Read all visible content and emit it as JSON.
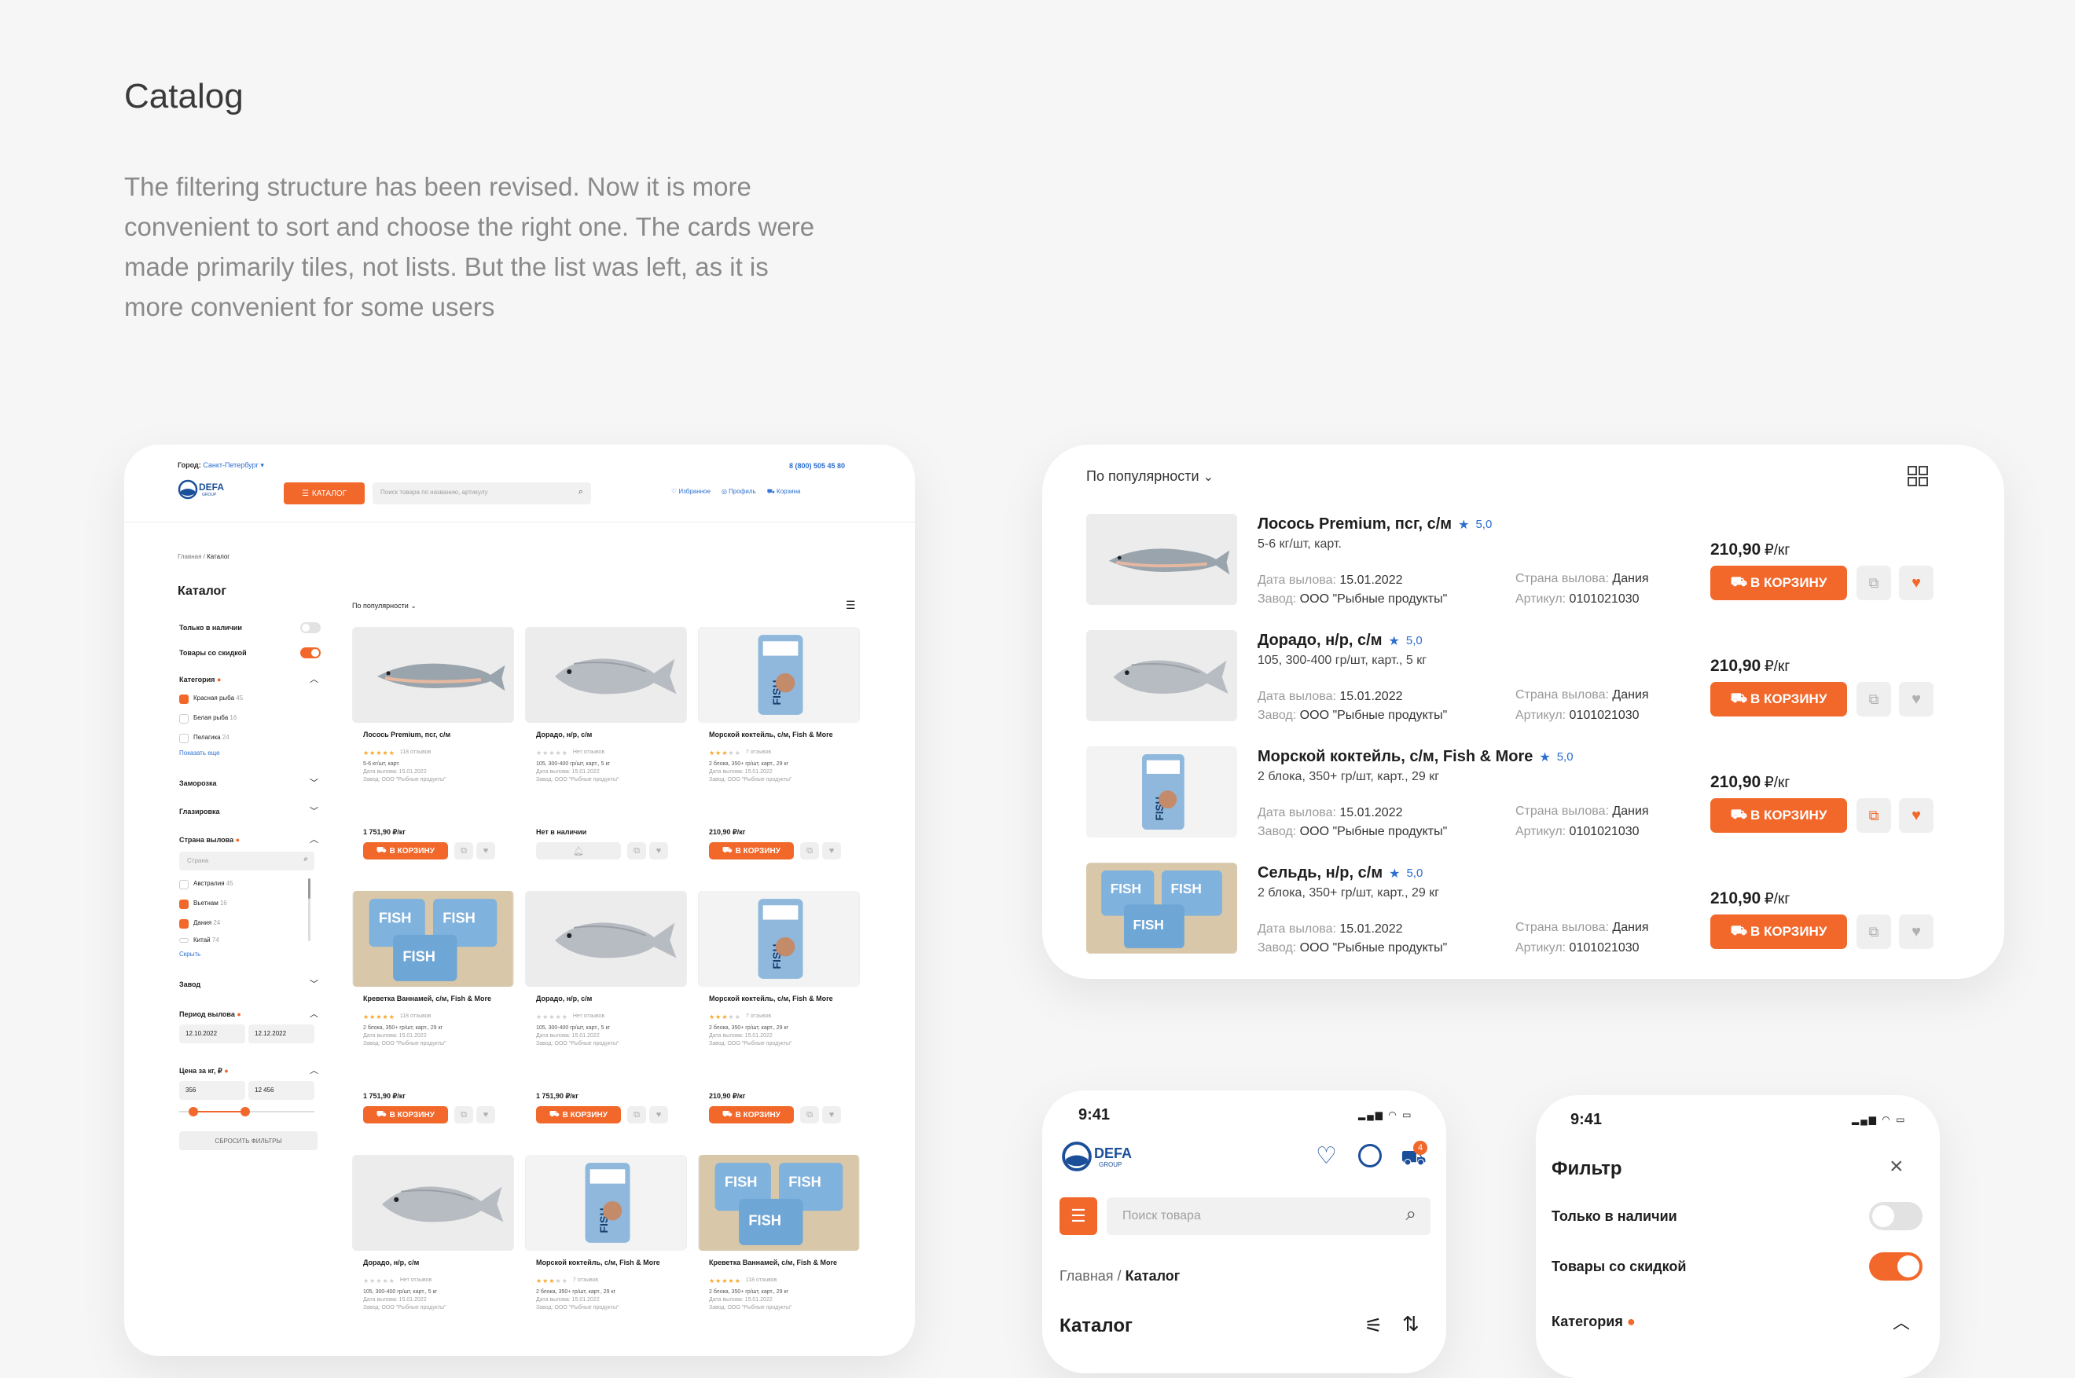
{
  "intro": {
    "title": "Catalog",
    "description": "The filtering structure has been revised. Now it is more convenient to sort and choose the right one. The cards were made primarily tiles, not lists. But the list was left, as it is more convenient for some users"
  },
  "desktop": {
    "city_label": "Город:",
    "city_value": "Санкт-Петербург",
    "phone": "8 (800) 505 45 80",
    "logo_text": "DEFA",
    "logo_sub": "GROUP",
    "catalog_button": "КАТАЛОГ",
    "search_placeholder": "Поиск товара по названию, артикулу",
    "nav": [
      "Избранное",
      "Профиль",
      "Корзина"
    ],
    "breadcrumb": [
      "Главная",
      "Каталог"
    ],
    "page_title": "Каталог",
    "sort_label": "По популярности",
    "filters": {
      "in_stock": "Только в наличии",
      "discount": "Товары со скидкой",
      "category": "Категория",
      "category_items": [
        {
          "label": "Красная рыба",
          "count": "45",
          "checked": true
        },
        {
          "label": "Белая рыба",
          "count": "16",
          "checked": false
        },
        {
          "label": "Пелагика",
          "count": "24",
          "checked": false
        }
      ],
      "show_more": "Показать еще",
      "freezing": "Заморозка",
      "glazing": "Глазировка",
      "country": "Страна вылова",
      "country_placeholder": "Страна",
      "country_items": [
        {
          "label": "Австралия",
          "count": "45",
          "checked": false
        },
        {
          "label": "Вьетнам",
          "count": "16",
          "checked": true
        },
        {
          "label": "Дания",
          "count": "24",
          "checked": true
        },
        {
          "label": "Китай",
          "count": "74",
          "checked": false
        }
      ],
      "hide": "Скрыть",
      "factory": "Завод",
      "period": "Период вылова",
      "date_from": "12.10.2022",
      "date_to": "12.12.2022",
      "price": "Цена за кг, ₽",
      "price_from": "356",
      "price_to": "12 456",
      "reset": "СБРОСИТЬ ФИЛЬТРЫ"
    },
    "products": [
      {
        "name": "Лосось Premium, псг, с/м",
        "reviews": "118 отзывов",
        "pack": "5-6 кг/шт, карт.",
        "date": "Дата вылова: 15.01.2022",
        "factory": "Завод: ООО \"Рыбные продукты\"",
        "price": "1 751,90 ₽/кг",
        "cart": "В КОРЗИНУ"
      },
      {
        "name": "Дорадо, н/р, с/м",
        "reviews": "Нет отзывов",
        "pack": "105, 300-400 гр/шт, карт., 5 кг",
        "date": "Дата вылова: 15.01.2022",
        "factory": "Завод: ООО \"Рыбные продукты\"",
        "price": "Нет в наличии",
        "cart": ""
      },
      {
        "name": "Морской коктейль, с/м, Fish & More",
        "reviews": "7 отзывов",
        "pack": "2 блока, 350+ гр/шт, карт., 29 кг",
        "date": "Дата вылова: 15.01.2022",
        "factory": "Завод: ООО \"Рыбные продукты\"",
        "price": "210,90 ₽/кг",
        "cart": "В КОРЗИНУ"
      },
      {
        "name": "Креветка Ваннамей, с/м, Fish & More",
        "reviews": "118 отзывов",
        "pack": "2 блока, 350+ гр/шт, карт., 29 кг",
        "date": "Дата вылова: 15.01.2022",
        "factory": "Завод: ООО \"Рыбные продукты\"",
        "price": "1 751,90 ₽/кг",
        "cart": "В КОРЗИНУ"
      },
      {
        "name": "Дорадо, н/р, с/м",
        "reviews": "Нет отзывов",
        "pack": "105, 300-400 гр/шт, карт., 5 кг",
        "date": "Дата вылова: 15.01.2022",
        "factory": "Завод: ООО \"Рыбные продукты\"",
        "price": "1 751,90 ₽/кг",
        "cart": "В КОРЗИНУ"
      },
      {
        "name": "Морской коктейль, с/м, Fish & More",
        "reviews": "7 отзывов",
        "pack": "2 блока, 350+ гр/шт, карт., 29 кг",
        "date": "Дата вылова: 15.01.2022",
        "factory": "Завод: ООО \"Рыбные продукты\"",
        "price": "210,90 ₽/кг",
        "cart": "В КОРЗИНУ"
      },
      {
        "name": "Дорадо, н/р, с/м",
        "reviews": "Нет отзывов",
        "pack": "105, 300-400 гр/шт, карт., 5 кг",
        "date": "Дата вылова: 15.01.2022",
        "factory": "Завод: ООО \"Рыбные продукты\"",
        "price": "",
        "cart": ""
      },
      {
        "name": "Морской коктейль, с/м, Fish & More",
        "reviews": "7 отзывов",
        "pack": "2 блока, 350+ гр/шт, карт., 29 кг",
        "date": "Дата вылова: 15.01.2022",
        "factory": "Завод: ООО \"Рыбные продукты\"",
        "price": "",
        "cart": ""
      },
      {
        "name": "Креветка Ваннамей, с/м, Fish & More",
        "reviews": "118 отзывов",
        "pack": "2 блока, 350+ гр/шт, карт., 29 кг",
        "date": "Дата вылова: 15.01.2022",
        "factory": "Завод: ООО \"Рыбные продукты\"",
        "price": "",
        "cart": ""
      }
    ]
  },
  "list": {
    "sort_label": "По популярности",
    "date_label": "Дата вылова:",
    "factory_label": "Завод:",
    "country_label": "Страна вылова:",
    "article_label": "Артикул:",
    "cart": "В КОРЗИНУ",
    "items": [
      {
        "name": "Лосось Premium, псг, с/м",
        "rating": "5,0",
        "pack": "5-6 кг/шт, карт.",
        "date": "15.01.2022",
        "factory": "ООО \"Рыбные продукты\"",
        "country": "Дания",
        "article": "0101021030",
        "price": "210,90",
        "unit": "₽/кг",
        "favorite": true
      },
      {
        "name": "Дорадо, н/р, с/м",
        "rating": "5,0",
        "pack": "105, 300-400 гр/шт, карт., 5 кг",
        "date": "15.01.2022",
        "factory": "ООО \"Рыбные продукты\"",
        "country": "Дания",
        "article": "0101021030",
        "price": "210,90",
        "unit": "₽/кг",
        "favorite": false
      },
      {
        "name": "Морской коктейль, с/м, Fish & More",
        "rating": "5,0",
        "pack": "2 блока, 350+ гр/шт, карт., 29 кг",
        "date": "15.01.2022",
        "factory": "ООО \"Рыбные продукты\"",
        "country": "Дания",
        "article": "0101021030",
        "price": "210,90",
        "unit": "₽/кг",
        "favorite": true
      },
      {
        "name": "Сельдь, н/р, с/м",
        "rating": "5,0",
        "pack": "2 блока, 350+ гр/шт, карт., 29 кг",
        "date": "15.01.2022",
        "factory": "ООО \"Рыбные продукты\"",
        "country": "Дания",
        "article": "0101021030",
        "price": "210,90",
        "unit": "₽/кг",
        "favorite": false
      }
    ]
  },
  "mobile1": {
    "time": "9:41",
    "logo_text": "DEFA",
    "logo_sub": "GROUP",
    "cart_count": "4",
    "search_placeholder": "Поиск товара",
    "breadcrumb_home": "Главная",
    "breadcrumb_sep": "/",
    "breadcrumb_current": "Каталог",
    "title": "Каталог"
  },
  "mobile2": {
    "time": "9:41",
    "title": "Фильтр",
    "in_stock": "Только в наличии",
    "discount": "Товары со скидкой",
    "category": "Категория"
  },
  "colors": {
    "accent": "#f2672a",
    "link": "#2c6fcf"
  }
}
